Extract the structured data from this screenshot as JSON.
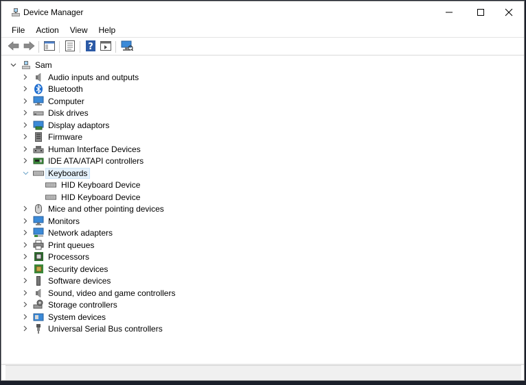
{
  "window": {
    "title": "Device Manager",
    "controls": {
      "minimize": "—",
      "maximize": "☐",
      "close": "✕"
    }
  },
  "menu": [
    "File",
    "Action",
    "View",
    "Help"
  ],
  "toolbar": {
    "buttons": [
      "back-icon",
      "forward-icon",
      "show-hide-console-tree-icon",
      "properties-icon",
      "help-icon",
      "action-pane-icon",
      "scan-hardware-icon"
    ]
  },
  "tree": {
    "root": {
      "label": "Sam",
      "expanded": true
    },
    "categories": [
      {
        "label": "Audio inputs and outputs",
        "icon": "speaker-icon"
      },
      {
        "label": "Bluetooth",
        "icon": "bluetooth-icon"
      },
      {
        "label": "Computer",
        "icon": "computer-icon"
      },
      {
        "label": "Disk drives",
        "icon": "disk-drive-icon"
      },
      {
        "label": "Display adaptors",
        "icon": "display-adapter-icon"
      },
      {
        "label": "Firmware",
        "icon": "firmware-icon"
      },
      {
        "label": "Human Interface Devices",
        "icon": "hid-icon"
      },
      {
        "label": "IDE ATA/ATAPI controllers",
        "icon": "ide-controller-icon"
      },
      {
        "label": "Keyboards",
        "icon": "keyboard-icon",
        "expanded": true,
        "selected": true,
        "children": [
          {
            "label": "HID Keyboard Device",
            "icon": "keyboard-icon"
          },
          {
            "label": "HID Keyboard Device",
            "icon": "keyboard-icon"
          }
        ]
      },
      {
        "label": "Mice and other pointing devices",
        "icon": "mouse-icon"
      },
      {
        "label": "Monitors",
        "icon": "monitor-icon"
      },
      {
        "label": "Network adapters",
        "icon": "network-adapter-icon"
      },
      {
        "label": "Print queues",
        "icon": "printer-icon"
      },
      {
        "label": "Processors",
        "icon": "processor-icon"
      },
      {
        "label": "Security devices",
        "icon": "security-device-icon"
      },
      {
        "label": "Software devices",
        "icon": "software-device-icon"
      },
      {
        "label": "Sound, video and game controllers",
        "icon": "speaker-icon"
      },
      {
        "label": "Storage controllers",
        "icon": "storage-controller-icon"
      },
      {
        "label": "System devices",
        "icon": "system-device-icon"
      },
      {
        "label": "Universal Serial Bus controllers",
        "icon": "usb-icon"
      }
    ]
  }
}
